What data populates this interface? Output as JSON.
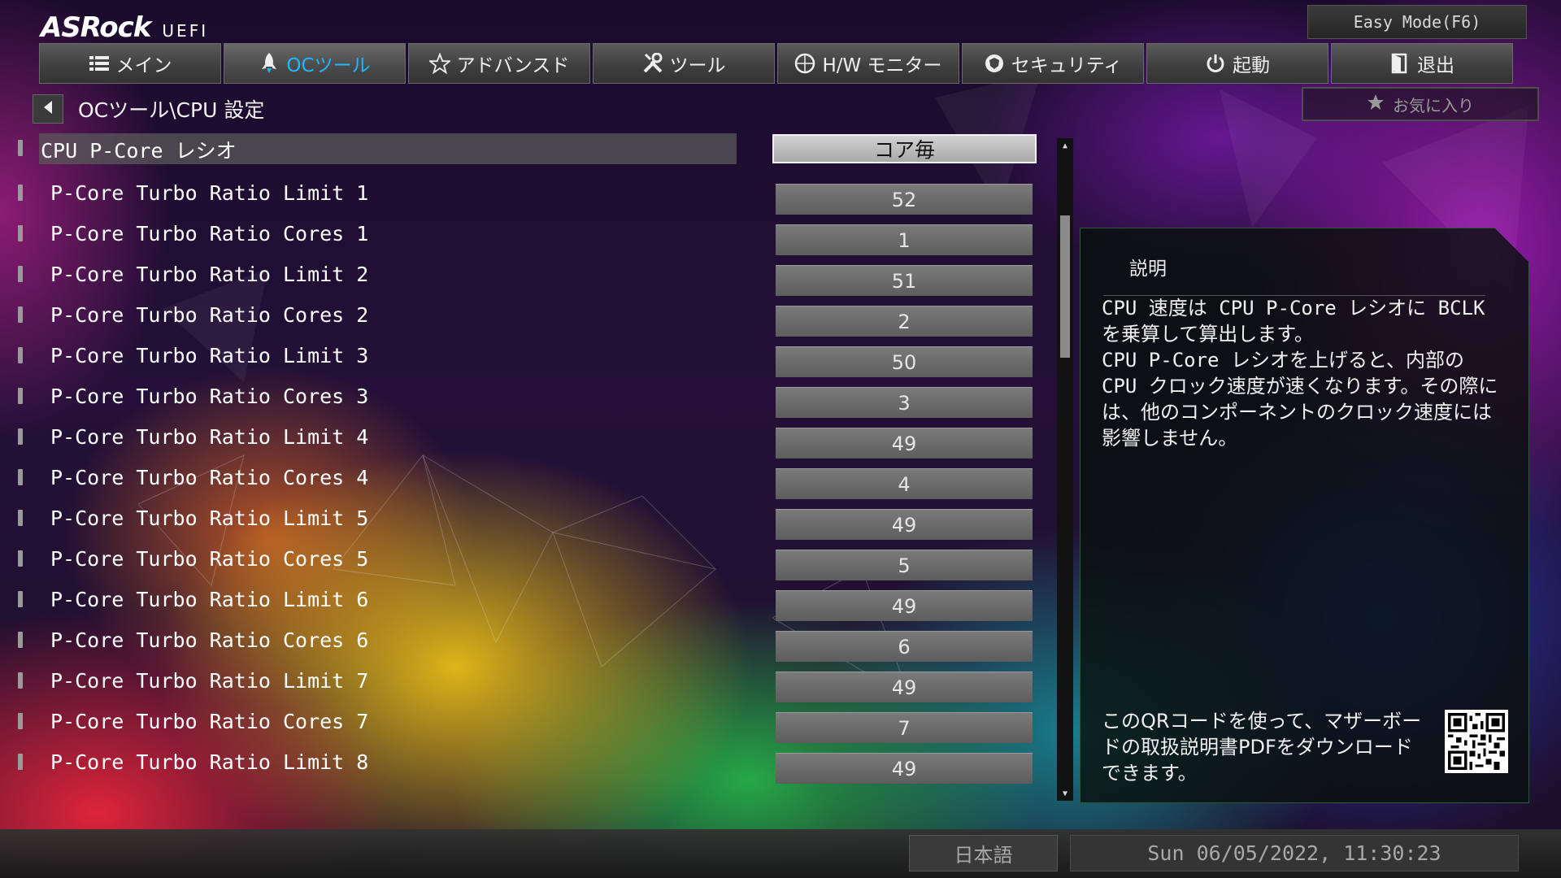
{
  "header": {
    "brand": "ASRock",
    "product": "UEFI",
    "easy_mode_label": "Easy Mode(F6)",
    "favorite_label": "お気に入り"
  },
  "tabs": [
    {
      "label": "メイン",
      "icon": "list-icon",
      "active": false
    },
    {
      "label": "OCツール",
      "icon": "rocket-icon",
      "active": true
    },
    {
      "label": "アドバンスド",
      "icon": "star-icon",
      "active": false
    },
    {
      "label": "ツール",
      "icon": "tools-icon",
      "active": false
    },
    {
      "label": "H/W モニター",
      "icon": "monitor-icon",
      "active": false
    },
    {
      "label": "セキュリティ",
      "icon": "shield-icon",
      "active": false
    },
    {
      "label": "起動",
      "icon": "power-icon",
      "active": false
    },
    {
      "label": "退出",
      "icon": "exit-icon",
      "active": false
    }
  ],
  "breadcrumb": "OCツール\\CPU 設定",
  "settings": [
    {
      "label": "CPU P-Core レシオ",
      "value": "コア毎"
    },
    {
      "label": "P-Core Turbo Ratio Limit 1",
      "value": "52"
    },
    {
      "label": "P-Core Turbo Ratio Cores 1",
      "value": "1"
    },
    {
      "label": "P-Core Turbo Ratio Limit 2",
      "value": "51"
    },
    {
      "label": "P-Core Turbo Ratio Cores 2",
      "value": "2"
    },
    {
      "label": "P-Core Turbo Ratio Limit 3",
      "value": "50"
    },
    {
      "label": "P-Core Turbo Ratio Cores 3",
      "value": "3"
    },
    {
      "label": "P-Core Turbo Ratio Limit 4",
      "value": "49"
    },
    {
      "label": "P-Core Turbo Ratio Cores 4",
      "value": "4"
    },
    {
      "label": "P-Core Turbo Ratio Limit 5",
      "value": "49"
    },
    {
      "label": "P-Core Turbo Ratio Cores 5",
      "value": "5"
    },
    {
      "label": "P-Core Turbo Ratio Limit 6",
      "value": "49"
    },
    {
      "label": "P-Core Turbo Ratio Cores 6",
      "value": "6"
    },
    {
      "label": "P-Core Turbo Ratio Limit 7",
      "value": "49"
    },
    {
      "label": "P-Core Turbo Ratio Cores 7",
      "value": "7"
    },
    {
      "label": "P-Core Turbo Ratio Limit 8",
      "value": "49"
    }
  ],
  "description": {
    "title": "説明",
    "body": "CPU 速度は CPU P-Core レシオに BCLK を乗算して算出します。\nCPU P-Core レシオを上げると、内部の CPU クロック速度が速くなります。その際には、他のコンポーネントのクロック速度には影響しません。",
    "qr_text": "このQRコードを使って、マザーボードの取扱説明書PDFをダウンロードできます。"
  },
  "footer": {
    "language": "日本語",
    "datetime": "Sun 06/05/2022, 11:30:23"
  },
  "colors": {
    "active_tab": "#1fb8ff",
    "panel_border": "#2c5a3a"
  }
}
